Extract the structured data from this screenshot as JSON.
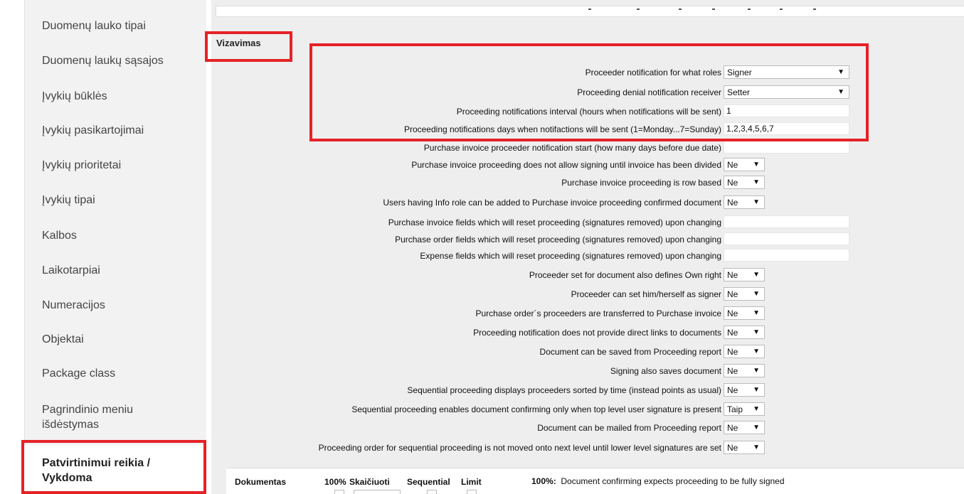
{
  "sidebar": {
    "items": [
      {
        "label": "Duomenų lauko tipai"
      },
      {
        "label": "Duomenų laukų sąsajos"
      },
      {
        "label": "Įvykių būklės"
      },
      {
        "label": "Įvykių pasikartojimai"
      },
      {
        "label": "Įvykių prioritetai"
      },
      {
        "label": "Įvykių tipai"
      },
      {
        "label": "Kalbos"
      },
      {
        "label": "Laikotarpiai"
      },
      {
        "label": "Numeracijos"
      },
      {
        "label": "Objektai"
      },
      {
        "label": "Package class"
      },
      {
        "label_line1": "Pagrindinio meniu",
        "label_line2": "išdėstymas"
      }
    ],
    "active": {
      "line1": "Patvirtinimui reikia /",
      "line2": "Vykdoma"
    }
  },
  "section": {
    "title": "Vizavimas"
  },
  "settings": [
    {
      "label": "Proceeder notification for what roles",
      "type": "select",
      "value": "Signer"
    },
    {
      "label": "Proceeding denial notification receiver",
      "type": "select",
      "value": "Setter"
    },
    {
      "label": "Proceeding notifications interval (hours when notifications will be sent)",
      "type": "input",
      "value": "1"
    },
    {
      "label": "Proceeding notifications days when notifactions will be sent (1=Monday...7=Sunday)",
      "type": "input",
      "value": "1,2,3,4,5,6,7"
    },
    {
      "label": "Purchase invoice proceeder notification start (how many days before due date)",
      "type": "input",
      "value": ""
    },
    {
      "label": "Purchase invoice proceeding does not allow signing until invoice has been divided",
      "type": "select",
      "value": "Ne"
    },
    {
      "label": "Purchase invoice proceeding is row based",
      "type": "select",
      "value": "Ne"
    },
    {
      "label": "Users having Info role can be added to Purchase invoice proceeding confirmed document",
      "type": "select",
      "value": "Ne"
    },
    {
      "label": "Purchase invoice fields which will reset proceeding (signatures removed) upon changing",
      "type": "input",
      "value": ""
    },
    {
      "label": "Purchase order fields which will reset proceeding (signatures removed) upon changing",
      "type": "input",
      "value": ""
    },
    {
      "label": "Expense fields which will reset proceeding (signatures removed) upon changing",
      "type": "input",
      "value": ""
    },
    {
      "label": "Proceeder set for document also defines Own right",
      "type": "select",
      "value": "Ne"
    },
    {
      "label": "Proceeder can set him/herself as signer",
      "type": "select",
      "value": "Ne"
    },
    {
      "label": "Purchase order´s proceeders are transferred to Purchase invoice",
      "type": "select",
      "value": "Ne"
    },
    {
      "label": "Proceeding notification does not provide direct links to documents",
      "type": "select",
      "value": "Ne"
    },
    {
      "label": "Document can be saved from Proceeding report",
      "type": "select",
      "value": "Ne"
    },
    {
      "label": "Signing also saves document",
      "type": "select",
      "value": "Ne"
    },
    {
      "label": "Sequential proceeding displays proceeders sorted by time (instead points as usual)",
      "type": "select",
      "value": "Ne"
    },
    {
      "label": "Sequential proceeding enables document confirming only when top level user signature is present",
      "type": "select",
      "value": "Taip"
    },
    {
      "label": "Document can be mailed from Proceeding report",
      "type": "select",
      "value": "Ne"
    },
    {
      "label": "Proceeding order for sequential proceeding is not moved onto next level until lower level signatures are set",
      "type": "select",
      "value": "Ne"
    }
  ],
  "table": {
    "headers": [
      "Dokumentas",
      "100%",
      "Skaičiuoti",
      "Sequential",
      "Limit"
    ],
    "note_key": "100%:",
    "note_text": "Document confirming expects proceeding to be fully signed"
  },
  "icons": {
    "dropdown": "▼"
  },
  "colors": {
    "highlight": "#e52226",
    "panel": "#eeeeee",
    "sidebar": "#f2f2f2"
  }
}
